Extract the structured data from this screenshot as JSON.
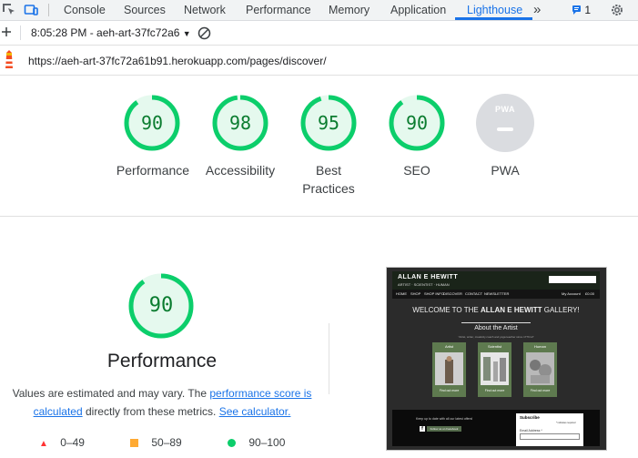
{
  "tabs": [
    {
      "label": "Console"
    },
    {
      "label": "Sources"
    },
    {
      "label": "Network"
    },
    {
      "label": "Performance"
    },
    {
      "label": "Memory"
    },
    {
      "label": "Application"
    },
    {
      "label": "Lighthouse"
    }
  ],
  "active_tab": "Lighthouse",
  "issues_count": "1",
  "toolbar": {
    "run_label": "8:05:28 PM - aeh-art-37fc72a6"
  },
  "url": "https://aeh-art-37fc72a61b91.herokuapp.com/pages/discover/",
  "scores": [
    {
      "label": "Performance",
      "value": "90",
      "fraction": 0.9
    },
    {
      "label": "Accessibility",
      "value": "98",
      "fraction": 0.98
    },
    {
      "label": "Best\nPractices",
      "value": "95",
      "fraction": 0.95
    },
    {
      "label": "SEO",
      "value": "90",
      "fraction": 0.9
    },
    {
      "label": "PWA",
      "value": "PWA"
    }
  ],
  "performance_detail": {
    "score": "90",
    "fraction": 0.9,
    "title": "Performance",
    "note_prefix": "Values are estimated and may vary. The ",
    "note_link1": "performance score is calculated",
    "note_mid": " directly from these metrics. ",
    "note_link2": "See calculator."
  },
  "legend": [
    {
      "label": "0–49",
      "color": "#ff3333"
    },
    {
      "label": "50–89",
      "color": "#ffaa33"
    },
    {
      "label": "90–100",
      "color": "#0cce6b"
    }
  ],
  "colors": {
    "pass_green": "#0cce6b",
    "pass_text": "#0a7c2f",
    "accent": "#1a73e8"
  },
  "preview": {
    "site_name": "ALLAN E HEWITT",
    "site_sub": "ARTIST · SCIENTIST · HUMAN",
    "nav": [
      "HOME",
      "SHOP",
      "SHOP INFO",
      "DISCOVER",
      "CONTACT",
      "NEWSLETTER"
    ],
    "account": "My Account",
    "basket": "£0.00",
    "welcome_prefix": "WELCOME TO THE ",
    "welcome_name": "ALLAN E HEWITT",
    "welcome_suffix": " GALLERY!",
    "about": "About the Artist",
    "tagline": "\"Artist, writer, creativity coach and yoga teacher since 1776 lol\"",
    "cards": [
      {
        "title": "Artist",
        "button": "Find out more"
      },
      {
        "title": "Scientist",
        "button": "Find out more"
      },
      {
        "title": "Human",
        "button": "Find out more"
      }
    ],
    "footer_text": "Keep up to date with all our latest offers!",
    "fb_button": "Follow us on Facebook",
    "subscribe_title": "Subscribe",
    "subscribe_required": "* indicates required",
    "email_label": "Email Address *"
  }
}
